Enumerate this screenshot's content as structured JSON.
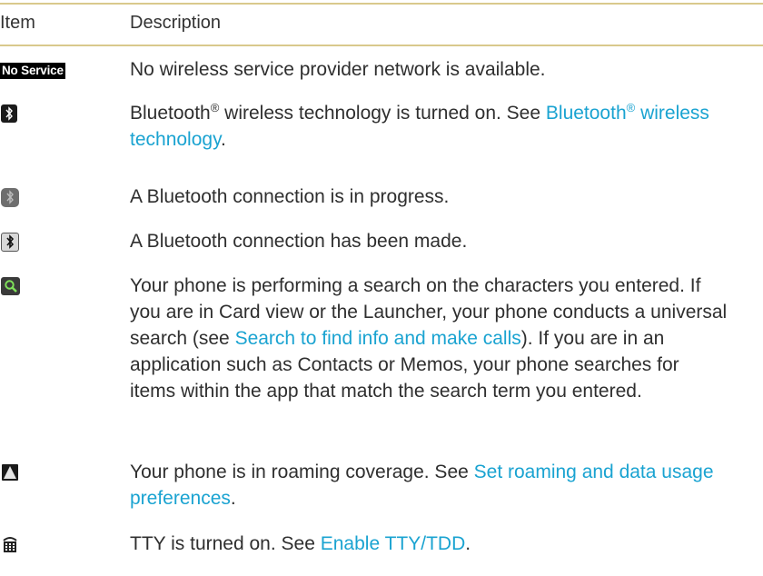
{
  "headers": {
    "item": "Item",
    "description": "Description"
  },
  "colors": {
    "rule": "#d9c98c",
    "link": "#1aa3d1",
    "text": "#2f2f2f"
  },
  "rows": [
    {
      "icon": "no-service-icon",
      "icon_text": "No Service",
      "text": "No wireless service provider network is available."
    },
    {
      "icon": "bluetooth-on-icon",
      "text1": "Bluetooth",
      "sup1": "®",
      "text2": " wireless technology is turned on. See ",
      "link1": "Bluetooth",
      "link_sup": "®",
      "link2": " wireless technology",
      "text3": "."
    },
    {
      "icon": "bluetooth-connecting-icon",
      "text": "A Bluetooth connection is in progress."
    },
    {
      "icon": "bluetooth-connected-icon",
      "text": "A Bluetooth connection has been made."
    },
    {
      "icon": "search-icon",
      "text1": "Your phone is performing a search on the characters you entered. If you are in Card view or the Launcher, your phone conducts a universal search (see ",
      "link": "Search to find info and make calls",
      "text2": "). If you are in an application such as Contacts or Memos, your phone searches for items within the app that match the search term you entered."
    },
    {
      "icon": "roaming-icon",
      "text1": "Your phone is in roaming coverage. See ",
      "link": "Set roaming and data usage preferences",
      "text2": "."
    },
    {
      "icon": "tty-icon",
      "text1": "TTY is turned on. See ",
      "link": "Enable TTY/TDD",
      "text2": "."
    }
  ]
}
